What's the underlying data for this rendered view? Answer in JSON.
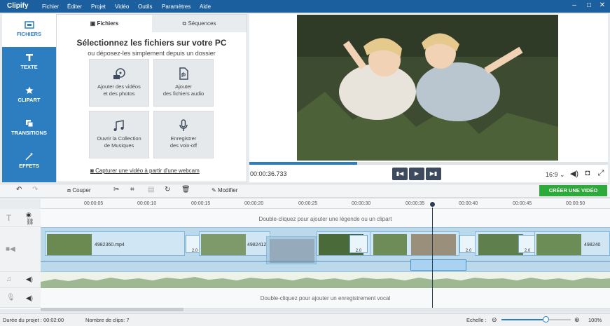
{
  "app": {
    "name": "Clipify"
  },
  "menu": [
    "Fichier",
    "Éditer",
    "Projet",
    "Vidéo",
    "Outils",
    "Paramètres",
    "Aide"
  ],
  "window_controls": [
    "–",
    "□",
    "✕"
  ],
  "nav": [
    {
      "label": "FICHIERS",
      "icon": "folder-icon",
      "active": true
    },
    {
      "label": "TEXTE",
      "icon": "text-icon",
      "active": false
    },
    {
      "label": "CLIPART",
      "icon": "star-icon",
      "active": false
    },
    {
      "label": "TRANSITIONS",
      "icon": "transitions-icon",
      "active": false
    },
    {
      "label": "EFFETS",
      "icon": "magic-wand-icon",
      "active": false
    }
  ],
  "file_panel": {
    "tabs": [
      "Fichiers",
      "Séquences"
    ],
    "title": "Sélectionnez les fichiers sur votre PC",
    "subtitle": "ou déposez-les simplement depuis un dossier",
    "tiles": [
      {
        "line1": "Ajouter des vidéos",
        "line2": "et des photos",
        "icon": "film-reel-icon"
      },
      {
        "line1": "Ajouter",
        "line2": "des fichiers audio",
        "icon": "audio-file-icon"
      },
      {
        "line1": "Ouvrir la Collection",
        "line2": "de Musiques",
        "icon": "music-notes-icon"
      },
      {
        "line1": "Enregistrer",
        "line2": "des voix-off",
        "icon": "microphone-icon"
      }
    ],
    "webcam": "Capturer une vidéo à partir d'une webcam"
  },
  "preview": {
    "timecode": "00:00:36.733",
    "progress": 0.3,
    "aspect": "16:9 ⌄"
  },
  "toolbar": {
    "cut": "Couper",
    "edit": "Modifier",
    "create": "CRÉER UNE VIDÉO"
  },
  "timeline": {
    "ruler": [
      "00:00:05",
      "00:00:10",
      "00:00:15",
      "00:00:20",
      "00:00:25",
      "00:00:30",
      "00:00:35",
      "00:00:40",
      "00:00:45",
      "00:00:50"
    ],
    "text_hint": "Double-cliquez pour ajouter une légende ou un clipart",
    "voice_hint": "Double-cliquez pour ajouter un enregistrement vocal",
    "clips": [
      "4982360.mp4",
      "4982412",
      "498240"
    ],
    "transition_label": "2.0"
  },
  "status": {
    "duration_label": "Durée du projet : 00:02:00",
    "clips_label": "Nombre de clips: 7",
    "scale_label": "Echelle :",
    "zoom": "100%",
    "zoom_level": 0.6
  },
  "colors": {
    "brand": "#2c7ec1",
    "titlebar": "#1b5f9e",
    "create": "#2daa3a",
    "playhead": "#2b3d55"
  }
}
